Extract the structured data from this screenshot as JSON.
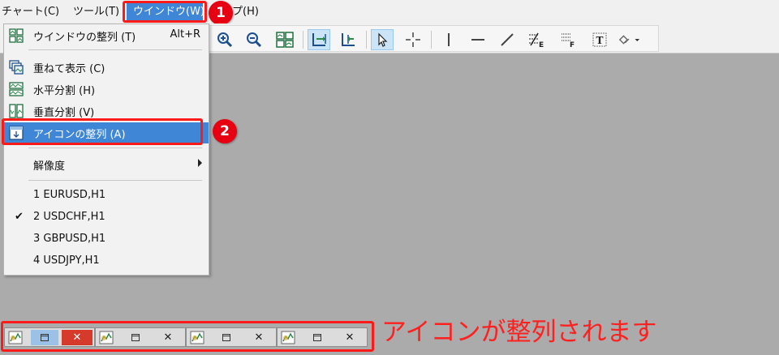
{
  "menubar": {
    "chart": "チャート(C)",
    "tools": "ツール(T)",
    "window": "ウインドウ(W)",
    "help": "プ(H)"
  },
  "toolbar": {
    "icons": [
      "zoom-in-icon",
      "zoom-out-icon",
      "tile-windows-icon",
      "chart-shift-icon",
      "autoscroll-icon",
      "cursor-icon",
      "crosshair-icon",
      "vertical-line-icon",
      "horizontal-line-icon",
      "trendline-icon",
      "fibonacci-icon",
      "fibonacci-fan-icon",
      "text-label-icon",
      "shapes-icon"
    ]
  },
  "window_menu": {
    "items": [
      {
        "label": "ウインドウの整列 (T)",
        "accel": "Alt+R",
        "icon": "tile-windows-icon"
      },
      {
        "label": "重ねて表示 (C)",
        "icon": "cascade-icon"
      },
      {
        "label": "水平分割 (H)",
        "icon": "tile-horizontal-icon"
      },
      {
        "label": "垂直分割 (V)",
        "icon": "tile-vertical-icon"
      },
      {
        "label": "アイコンの整列 (A)",
        "icon": "arrange-icons-icon"
      },
      {
        "label": "解像度"
      },
      {
        "label": "1 EURUSD,H1"
      },
      {
        "label": "2 USDCHF,H1",
        "checked": true
      },
      {
        "label": "3 GBPUSD,H1"
      },
      {
        "label": "4 USDJPY,H1"
      }
    ],
    "check_glyph": "✔"
  },
  "badges": {
    "one": "1",
    "two": "2"
  },
  "minimized_windows": [
    {
      "close": "✕",
      "active": true
    },
    {
      "close": "✕",
      "active": false
    },
    {
      "close": "✕",
      "active": false
    },
    {
      "close": "✕",
      "active": false
    }
  ],
  "caption": "アイコンが整列されます",
  "colors": {
    "accent": "#3f86d6",
    "annotation": "#ff1a1a",
    "badge": "#e60012",
    "workspace": "#ababab"
  }
}
